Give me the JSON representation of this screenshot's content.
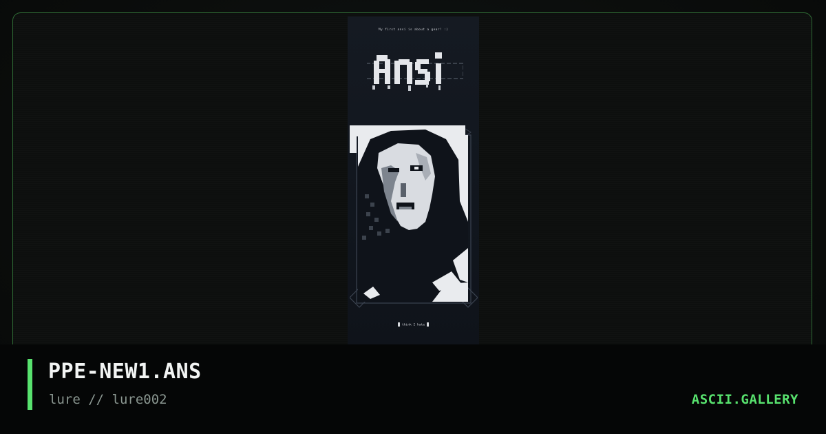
{
  "artwork": {
    "intro_text": "My first ansi is about a gear! :)",
    "logo_text": "ansi",
    "footer_text": "think I hate"
  },
  "info": {
    "title": "PPE-NEW1.ANS",
    "subtitle": "lure // lure002",
    "brand": "ASCII.GALLERY"
  },
  "colors": {
    "accent": "#58e26e",
    "frame_border": "#2f6b35",
    "background": "#0b0e0c",
    "info_bar": "#050606"
  }
}
